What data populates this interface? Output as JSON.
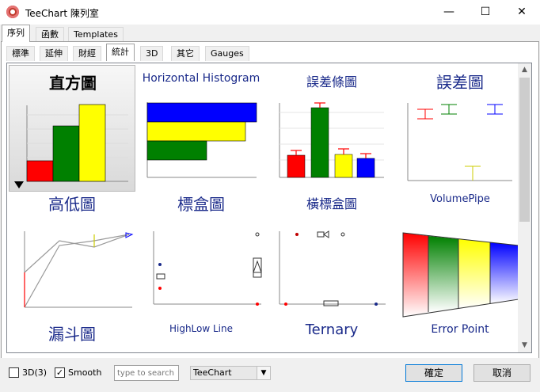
{
  "window": {
    "title": "TeeChart 陳列室",
    "minimize_glyph": "—",
    "maximize_glyph": "☐",
    "close_glyph": "✕"
  },
  "main_tabs": [
    {
      "label": "序列",
      "active": true
    },
    {
      "label": "函數",
      "active": false
    },
    {
      "label": "Templates",
      "active": false
    }
  ],
  "sub_tabs": [
    {
      "label": "標準",
      "active": false
    },
    {
      "label": "延伸",
      "active": false
    },
    {
      "label": "財經",
      "active": false
    },
    {
      "label": "統計",
      "active": true
    },
    {
      "label": "3D",
      "active": false
    },
    {
      "label": "其它",
      "active": false
    },
    {
      "label": "Gauges",
      "active": false
    }
  ],
  "gallery": {
    "items": [
      {
        "label": "直方圖",
        "selected": true
      },
      {
        "label": "Horizontal Histogram",
        "selected": false
      },
      {
        "label": "誤差條圖",
        "selected": false
      },
      {
        "label": "誤差圖",
        "selected": false
      },
      {
        "label": "高低圖",
        "selected": false
      },
      {
        "label": "標盒圖",
        "selected": false
      },
      {
        "label": "橫標盒圖",
        "selected": false
      },
      {
        "label": "VolumePipe",
        "selected": false
      },
      {
        "label": "漏斗圖",
        "selected": false
      },
      {
        "label": "HighLow Line",
        "selected": false
      },
      {
        "label": "Ternary",
        "selected": false
      },
      {
        "label": "Error Point",
        "selected": false
      }
    ]
  },
  "bottom_bar": {
    "option_3d_label": "3D(3)",
    "option_3d_checked": false,
    "smooth_label": "Smooth",
    "smooth_checked": true,
    "search_placeholder": "type to search",
    "theme_select_value": "TeeChart",
    "ok_label": "確定",
    "cancel_label": "取消"
  },
  "colors": {
    "red": "#ff0000",
    "green": "#008000",
    "yellow": "#ffff00",
    "blue": "#0000ff",
    "label_navy": "#1a2a8a"
  }
}
